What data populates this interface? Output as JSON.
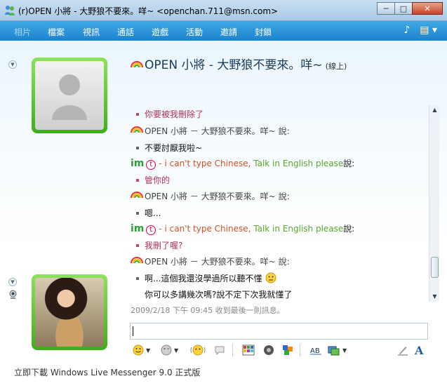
{
  "window": {
    "title": "(r)OPEN 小將 - 大野狼不要來。咩~ <openchan.711@msn.com>",
    "minimize": "─",
    "maximize": "□",
    "close": "✕"
  },
  "menu": {
    "items": [
      "相片",
      "檔案",
      "視訊",
      "通話",
      "遊戲",
      "活動",
      "邀請",
      "封鎖"
    ]
  },
  "contact": {
    "name": "OPEN 小將 - 大野狼不要來。咩~",
    "status": "(線上)"
  },
  "conversation": {
    "says": "說:",
    "contact_sender": "OPEN 小將 － 大野狼不要來。咩~",
    "me_t": "t",
    "me_name_part1": "- i can't type Chinese,",
    "me_name_part2": "Talk in English please",
    "im_logo": "im",
    "messages": {
      "m1": "你要被我刪除了",
      "m2": "不要討厭我啦~",
      "m3": "管你的",
      "m4": "嗯...",
      "m5": "我刪了喔?",
      "m6": "啊...這個我還沒學過所以聽不懂",
      "m7": "你可以多講幾次嗎?說不定下次我就懂了"
    },
    "timestamp": "2009/2/18 下午 09:45 收到最後一則訊息。"
  },
  "input": {
    "value": ""
  },
  "statusbar": {
    "text": "立即下載 Windows Live Messenger 9.0 正式版"
  },
  "colors": {
    "menubar": "#1d82cc",
    "avatar_frame": "#3fae1a",
    "my_messages": "#b5315a"
  }
}
